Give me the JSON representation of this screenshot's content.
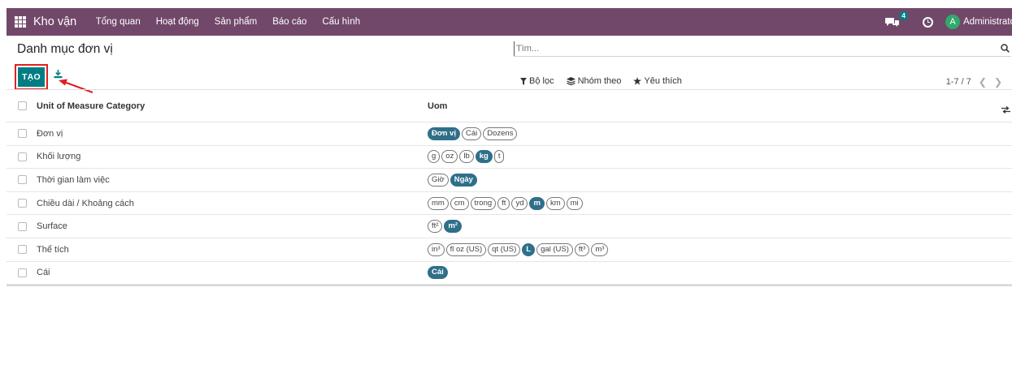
{
  "navbar": {
    "brand": "Kho vận",
    "menu": [
      "Tổng quan",
      "Hoạt động",
      "Sản phẩm",
      "Báo cáo",
      "Cấu hình"
    ],
    "message_count": "4",
    "avatar_letter": "A",
    "user_name": "Administrator"
  },
  "control_panel": {
    "title": "Danh mục đơn vị",
    "search_placeholder": "Tìm...",
    "create_label": "TẠO",
    "filters_label": "Bộ lọc",
    "group_by_label": "Nhóm theo",
    "favorites_label": "Yêu thích",
    "pager": "1-7 / 7"
  },
  "table": {
    "headers": {
      "name": "Unit of Measure Category",
      "uom": "Uom"
    },
    "rows": [
      {
        "name": "Đơn vị",
        "uoms": [
          {
            "label": "Đơn vị",
            "ref": true
          },
          {
            "label": "Cái",
            "ref": false
          },
          {
            "label": "Dozens",
            "ref": false
          }
        ]
      },
      {
        "name": "Khối lượng",
        "uoms": [
          {
            "label": "g",
            "ref": false
          },
          {
            "label": "oz",
            "ref": false
          },
          {
            "label": "lb",
            "ref": false
          },
          {
            "label": "kg",
            "ref": true
          },
          {
            "label": "t",
            "ref": false
          }
        ]
      },
      {
        "name": "Thời gian làm việc",
        "uoms": [
          {
            "label": "Giờ",
            "ref": false
          },
          {
            "label": "Ngày",
            "ref": true
          }
        ]
      },
      {
        "name": "Chiều dài / Khoảng cách",
        "uoms": [
          {
            "label": "mm",
            "ref": false
          },
          {
            "label": "cm",
            "ref": false
          },
          {
            "label": "trong",
            "ref": false
          },
          {
            "label": "ft",
            "ref": false
          },
          {
            "label": "yd",
            "ref": false
          },
          {
            "label": "m",
            "ref": true
          },
          {
            "label": "km",
            "ref": false
          },
          {
            "label": "mi",
            "ref": false
          }
        ]
      },
      {
        "name": "Surface",
        "uoms": [
          {
            "label": "ft²",
            "ref": false
          },
          {
            "label": "m²",
            "ref": true
          }
        ]
      },
      {
        "name": "Thể tích",
        "uoms": [
          {
            "label": "in³",
            "ref": false
          },
          {
            "label": "fl oz (US)",
            "ref": false
          },
          {
            "label": "qt (US)",
            "ref": false
          },
          {
            "label": "L",
            "ref": true
          },
          {
            "label": "gal (US)",
            "ref": false
          },
          {
            "label": "ft³",
            "ref": false
          },
          {
            "label": "m³",
            "ref": false
          }
        ]
      },
      {
        "name": "Cái",
        "uoms": [
          {
            "label": "Cái",
            "ref": true
          }
        ]
      }
    ]
  },
  "colors": {
    "navbar": "#71486a",
    "primary": "#017e84",
    "reference_tag": "#2f6f89",
    "highlight": "#e02020"
  }
}
